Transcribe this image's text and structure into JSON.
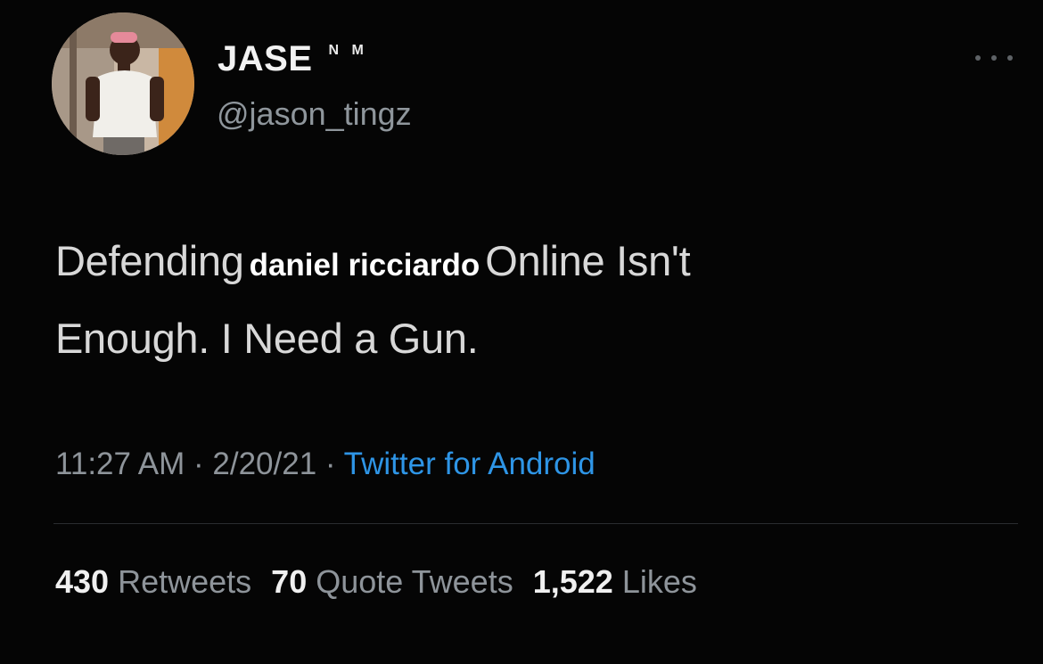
{
  "user": {
    "display_name": "JASE",
    "name_suffix": "N M",
    "handle": "@jason_tingz",
    "avatar_icon": "profile-photo"
  },
  "tweet": {
    "text_before": "Defending",
    "censor_text": "daniel ricciardo",
    "text_after_line1": "Online Isn't",
    "text_line2": "Enough. I Need a Gun."
  },
  "meta": {
    "time": "11:27 AM",
    "separator": "·",
    "date": "2/20/21",
    "source": "Twitter for Android"
  },
  "stats": {
    "retweets_count": "430",
    "retweets_label": "Retweets",
    "quotes_count": "70",
    "quotes_label": "Quote Tweets",
    "likes_count": "1,522",
    "likes_label": "Likes"
  },
  "colors": {
    "background": "#050505",
    "link": "#2e95e6",
    "secondary_text": "#8e949a"
  }
}
